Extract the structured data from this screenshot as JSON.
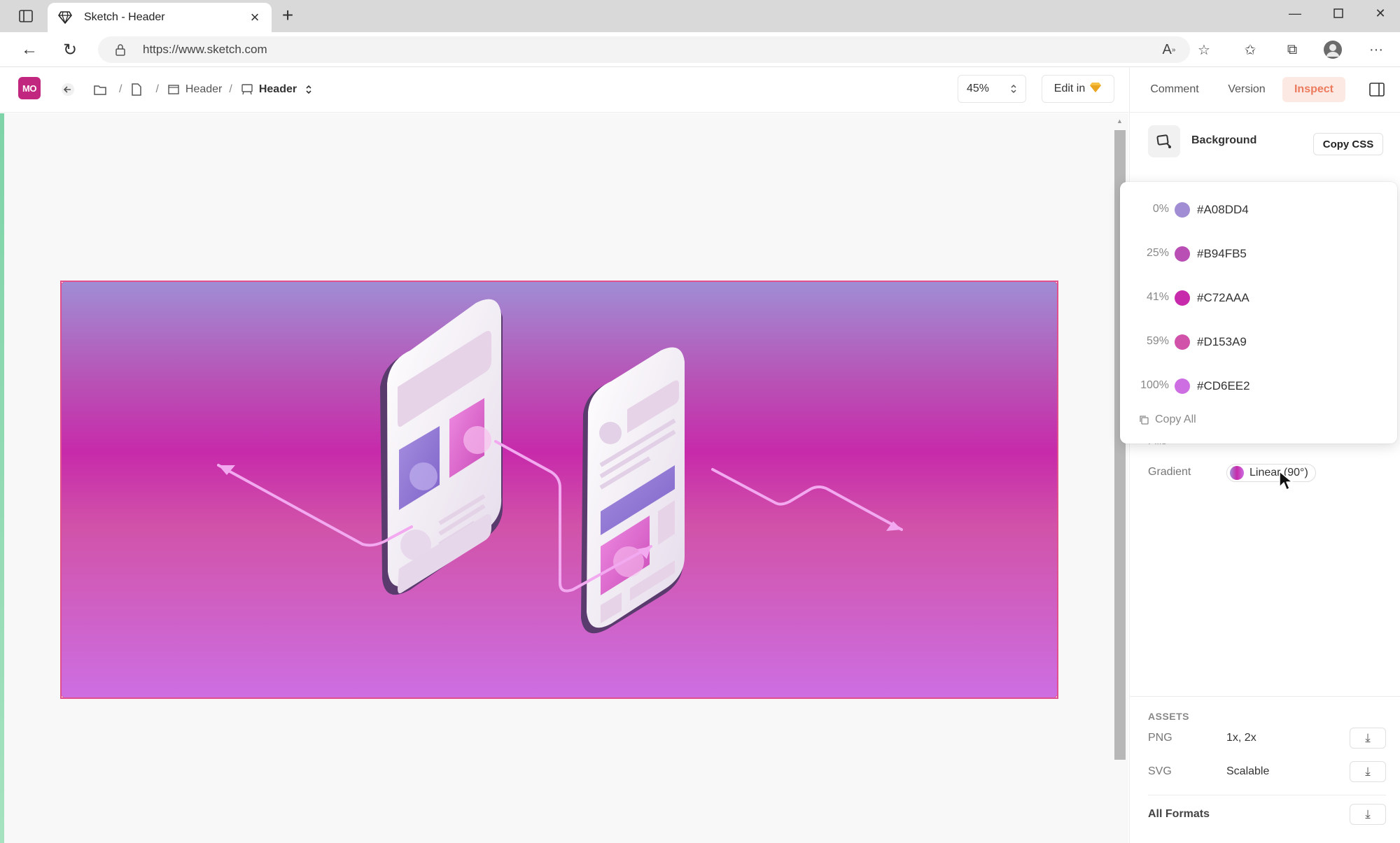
{
  "browser": {
    "tab_title": "Sketch - Header",
    "url": "https://www.sketch.com"
  },
  "app": {
    "logo_text": "MO",
    "breadcrumb": {
      "sep": "/",
      "page": "Header",
      "artboard": "Header"
    },
    "zoom": "45%",
    "edit_in_label": "Edit in"
  },
  "panel": {
    "tabs": {
      "comment": "Comment",
      "version": "Version",
      "inspect": "Inspect"
    },
    "active_tab": "Inspect",
    "section_title": "Background",
    "copy_css_label": "Copy CSS",
    "fills_label": "Fills",
    "gradient": {
      "label": "Gradient",
      "value": "Linear (90°)"
    },
    "popover": {
      "stops": [
        {
          "pct": "0%",
          "hex": "#A08DD4",
          "color": "#A08DD4"
        },
        {
          "pct": "25%",
          "hex": "#B94FB5",
          "color": "#B94FB5"
        },
        {
          "pct": "41%",
          "hex": "#C72AAA",
          "color": "#C72AAA"
        },
        {
          "pct": "59%",
          "hex": "#D153A9",
          "color": "#D153A9"
        },
        {
          "pct": "100%",
          "hex": "#CD6EE2",
          "color": "#CD6EE2"
        }
      ],
      "copy_all_label": "Copy All"
    },
    "assets": {
      "title": "ASSETS",
      "png": {
        "label": "PNG",
        "value": "1x, 2x"
      },
      "svg": {
        "label": "SVG",
        "value": "Scalable"
      },
      "all_formats_label": "All Formats"
    }
  },
  "colors": {
    "accent": "#EC7A5C",
    "brand": "#C2277F",
    "artboard_border": "#E1508C"
  }
}
